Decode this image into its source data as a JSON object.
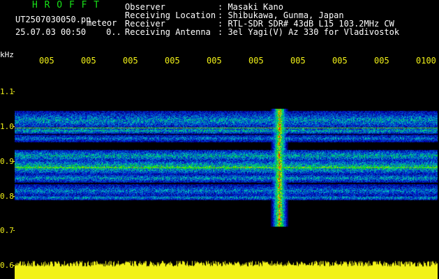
{
  "app": {
    "logo": "H R O F F T",
    "filename": "UT2507030050.pn",
    "detection_label": "meteor",
    "datetime": "25.07.03 00:50",
    "counter": "0.."
  },
  "station": {
    "labels": "Observer\nReceiving Location\nReceiver\nReceiving Antenna",
    "values": ": Masaki Kano\n: Shibukawa, Gunma, Japan\n: RTL-SDR SDR# 43dB L15 103.2MHz CW\n: 3el Yagi(V) Az 330 for Vladivostok"
  },
  "axis": {
    "freq_unit": "kHz",
    "freq_ticks": [
      "1.1",
      "1.0",
      "0.9",
      "0.8",
      "0.7",
      "0.6"
    ],
    "time_ticks": [
      "005",
      "005",
      "005",
      "005",
      "005",
      "005",
      "005",
      "005",
      "005",
      "0100"
    ]
  },
  "colors": {
    "background": "#000000",
    "label_green": "#18e018",
    "axis_yellow": "#f2f218",
    "text_white": "#ffffff",
    "noise_low": "#000050",
    "noise_mid": "#0a32b4",
    "echo_hot": "#ff2020"
  }
}
